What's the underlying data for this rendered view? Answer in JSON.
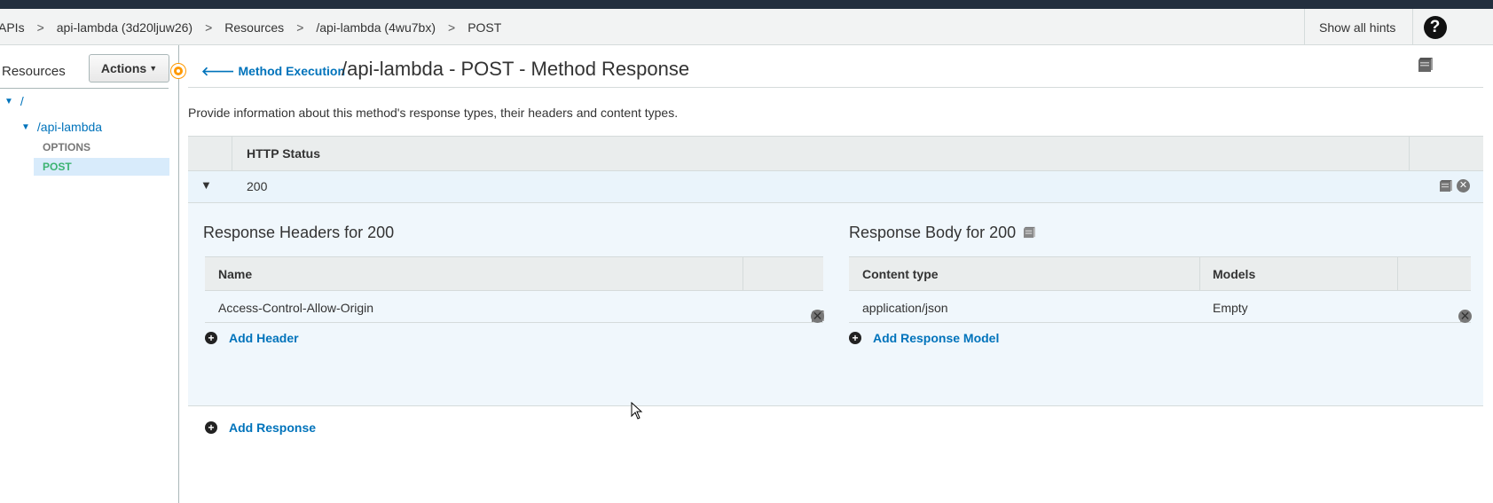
{
  "breadcrumb": {
    "items": [
      "APIs",
      "api-lambda (3d20ljuw26)",
      "Resources",
      "/api-lambda (4wu7bx)",
      "POST"
    ],
    "separator": ">"
  },
  "header": {
    "hints_label": "Show all hints",
    "help_glyph": "?"
  },
  "sidebar": {
    "title": "Resources",
    "actions_label": "Actions",
    "tree": {
      "root": "/",
      "resource": "/api-lambda",
      "methods": [
        "OPTIONS",
        "POST"
      ]
    }
  },
  "main": {
    "back_link": "Method Execution",
    "title": "/api-lambda - POST - Method Response",
    "description": "Provide information about this method's response types, their headers and content types.",
    "status_table": {
      "header": "HTTP Status",
      "rows": [
        "200"
      ]
    },
    "headers_section": {
      "title": "Response Headers for 200",
      "col_name": "Name",
      "rows": [
        "Access-Control-Allow-Origin"
      ],
      "add_label": "Add Header"
    },
    "body_section": {
      "title": "Response Body for 200",
      "col_content_type": "Content type",
      "col_models": "Models",
      "rows": [
        {
          "content_type": "application/json",
          "model": "Empty"
        }
      ],
      "add_label": "Add Response Model"
    },
    "add_response_label": "Add Response"
  },
  "colors": {
    "link": "#0073bb",
    "accent": "#ff9900",
    "post_green": "#3cb371",
    "selected_bg": "#d8ebfb"
  },
  "icons": [
    "help-icon",
    "book-icon",
    "pencil-icon",
    "remove-icon",
    "plus-icon",
    "caret-down-icon",
    "arrow-left-icon"
  ]
}
